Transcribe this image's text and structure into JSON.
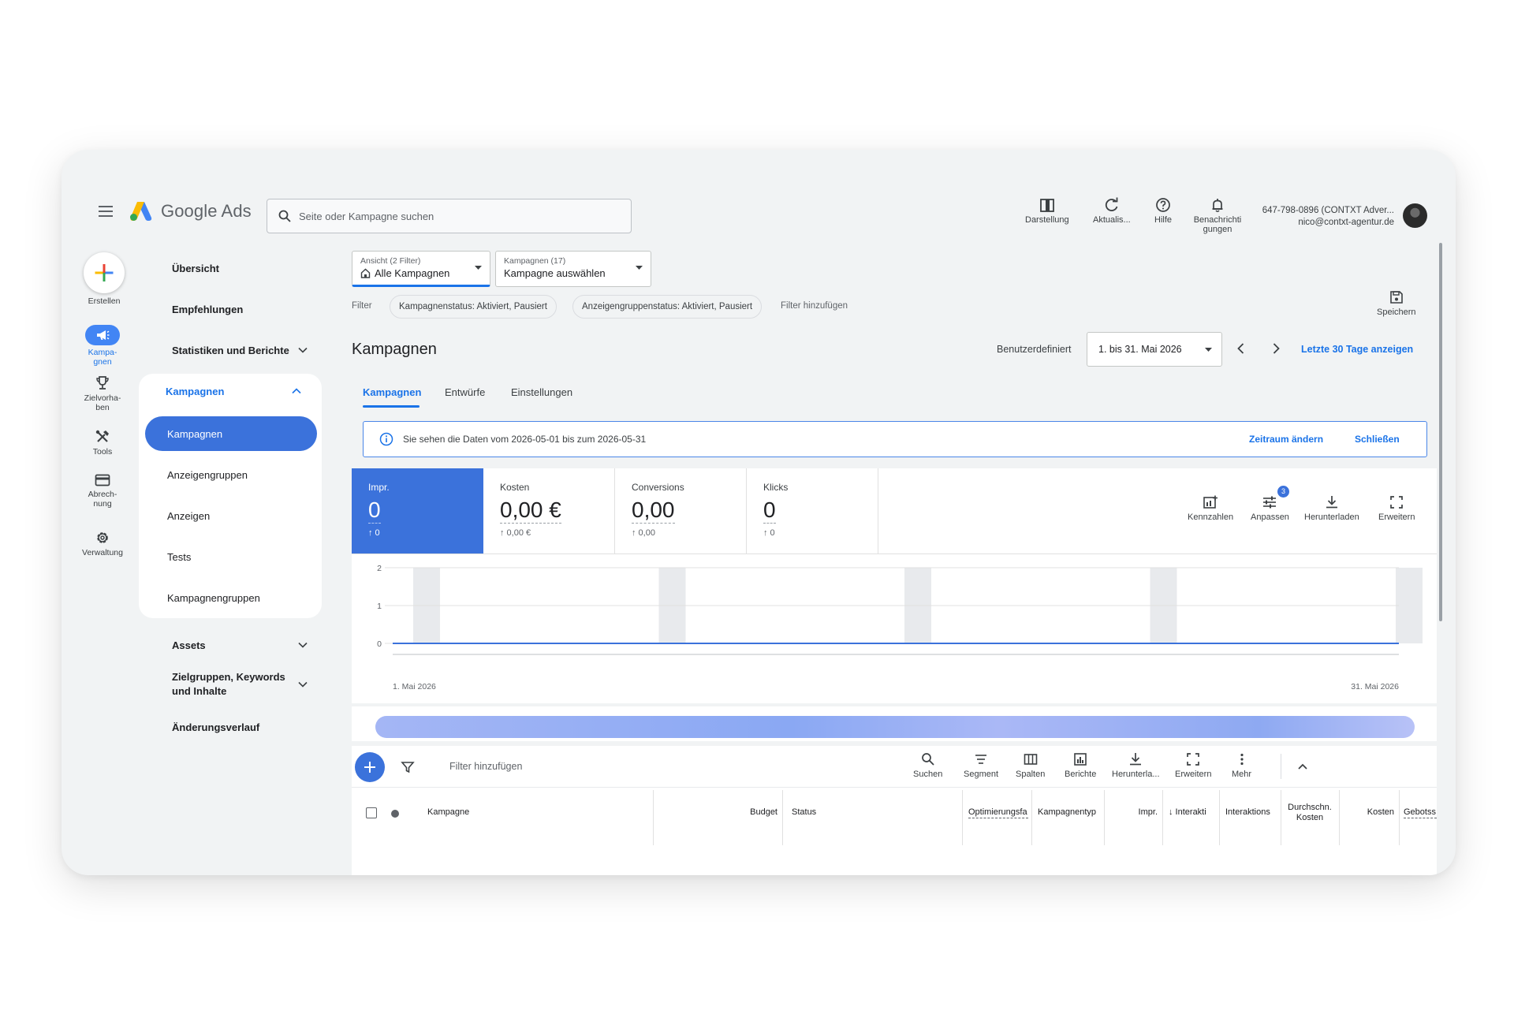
{
  "header": {
    "logo_text": "Google Ads",
    "search_placeholder": "Seite oder Kampagne suchen",
    "actions": [
      {
        "label": "Darstellung",
        "icon": "layout-icon"
      },
      {
        "label": "Aktualis...",
        "icon": "refresh-icon"
      },
      {
        "label": "Hilfe",
        "icon": "help-icon"
      },
      {
        "label": "Benachrichti gungen",
        "icon": "bell-icon"
      }
    ],
    "account_line1": "647-798-0896 (CONTXT Adver...",
    "account_line2": "nico@contxt-agentur.de"
  },
  "rail": {
    "create": "Erstellen",
    "items": [
      {
        "label": "Kampa-gnen",
        "icon": "campaigns-megaphone-icon"
      },
      {
        "label": "Zielvorha-ben",
        "icon": "trophy-icon"
      },
      {
        "label": "Tools",
        "icon": "tools-icon"
      },
      {
        "label": "Abrech-nung",
        "icon": "credit-card-icon"
      },
      {
        "label": "Verwaltung",
        "icon": "gear-icon"
      }
    ]
  },
  "nav": {
    "overview": "Übersicht",
    "recommendations": "Empfehlungen",
    "stats": "Statistiken und Berichte",
    "campaigns_group": "Kampagnen",
    "sub": [
      "Kampagnen",
      "Anzeigengruppen",
      "Anzeigen",
      "Tests",
      "Kampagnengruppen"
    ],
    "assets": "Assets",
    "audiences": "Zielgruppen, Keywords und Inhalte",
    "history": "Änderungsverlauf"
  },
  "view_dropdown": {
    "small": "Ansicht (2 Filter)",
    "value": "Alle Kampagnen"
  },
  "campaign_dropdown": {
    "small": "Kampagnen (17)",
    "value": "Kampagne auswählen"
  },
  "filters": {
    "label": "Filter",
    "chips": [
      "Kampagnenstatus: Aktiviert, Pausiert",
      "Anzeigengruppenstatus: Aktiviert, Pausiert"
    ],
    "add": "Filter hinzufügen"
  },
  "save_label": "Speichern",
  "page_title": "Kampagnen",
  "date": {
    "mode": "Benutzerdefiniert",
    "range": "1. bis 31. Mai 2026",
    "last30": "Letzte 30 Tage anzeigen"
  },
  "tabs": [
    "Kampagnen",
    "Entwürfe",
    "Einstellungen"
  ],
  "info": {
    "text": "Sie sehen die Daten vom 2026-05-01 bis zum 2026-05-31",
    "change": "Zeitraum ändern",
    "close": "Schließen"
  },
  "metrics": [
    {
      "label": "Impr.",
      "value": "0",
      "change": "↑ 0"
    },
    {
      "label": "Kosten",
      "value": "0,00 €",
      "change": "↑ 0,00 €"
    },
    {
      "label": "Conversions",
      "value": "0,00",
      "change": "↑ 0,00"
    },
    {
      "label": "Klicks",
      "value": "0",
      "change": "↑ 0"
    }
  ],
  "chart_tools": [
    {
      "label": "Kennzahlen",
      "icon": "chart-add-icon"
    },
    {
      "label": "Anpassen",
      "icon": "tune-icon",
      "badge": "3"
    },
    {
      "label": "Herunterladen",
      "icon": "download-icon"
    },
    {
      "label": "Erweitern",
      "icon": "fullscreen-icon"
    }
  ],
  "chart_data": {
    "type": "line",
    "x_start": "1. Mai 2026",
    "x_end": "31. Mai 2026",
    "y_ticks": [
      "0",
      "1",
      "2"
    ],
    "ylim": [
      0,
      2
    ],
    "x": [
      "2026-05-01",
      "2026-05-31"
    ],
    "series": [
      {
        "values": [
          0,
          0
        ]
      }
    ],
    "weekend_bands": 5,
    "color": "#3b72db"
  },
  "table_toolbar": {
    "filter_add": "Filter hinzufügen",
    "tools": [
      {
        "label": "Suchen",
        "icon": "search-icon"
      },
      {
        "label": "Segment",
        "icon": "segment-icon"
      },
      {
        "label": "Spalten",
        "icon": "columns-icon"
      },
      {
        "label": "Berichte",
        "icon": "reports-icon"
      },
      {
        "label": "Herunterla...",
        "icon": "download-icon"
      },
      {
        "label": "Erweitern",
        "icon": "fullscreen-icon"
      },
      {
        "label": "Mehr",
        "icon": "more-vert-icon"
      }
    ]
  },
  "table_headers": {
    "campaign": "Kampagne",
    "budget": "Budget",
    "status": "Status",
    "opt": "Optimierungsfa",
    "type": "Kampagnentyp",
    "impr": "Impr.",
    "interact": "↓ Interakti",
    "interact_rate": "Interaktions",
    "avg_cost": "Durchschn. Kosten",
    "cost": "Kosten",
    "bid": "Gebotss"
  }
}
